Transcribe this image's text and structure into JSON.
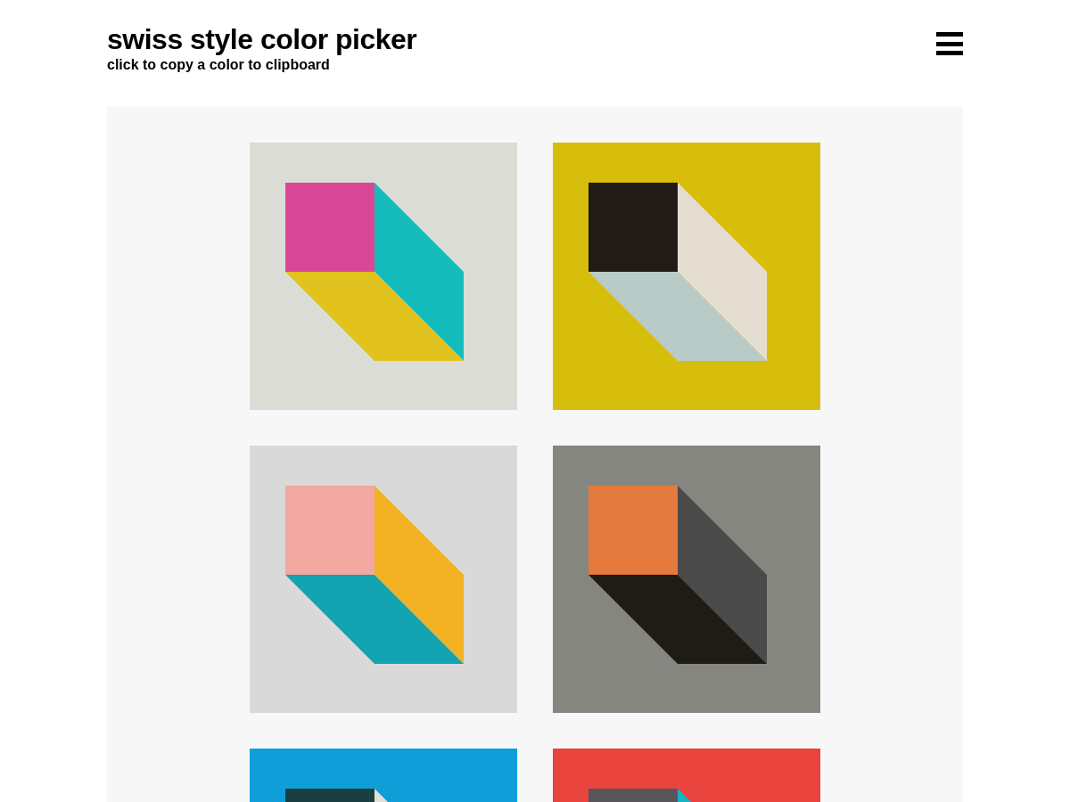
{
  "header": {
    "title": "swiss style color picker",
    "subtitle": "click to copy a color to clipboard"
  },
  "swatches": [
    {
      "faces": [
        {
          "kind": "background",
          "color": "#dcdcd6"
        },
        {
          "kind": "front",
          "color": "#d94896"
        },
        {
          "kind": "side",
          "color": "#14bcbc"
        },
        {
          "kind": "bottom",
          "color": "#e2c21e"
        }
      ]
    },
    {
      "faces": [
        {
          "kind": "background",
          "color": "#d8be0c"
        },
        {
          "kind": "front",
          "color": "#221a14"
        },
        {
          "kind": "side",
          "color": "#e6ddd2"
        },
        {
          "kind": "bottom",
          "color": "#b9cbc6"
        }
      ]
    },
    {
      "faces": [
        {
          "kind": "background",
          "color": "#d9d9d9"
        },
        {
          "kind": "front",
          "color": "#f2a7a0"
        },
        {
          "kind": "side",
          "color": "#f2b224"
        },
        {
          "kind": "bottom",
          "color": "#13a3b0"
        }
      ]
    },
    {
      "faces": [
        {
          "kind": "background",
          "color": "#868681"
        },
        {
          "kind": "front",
          "color": "#e57a3e"
        },
        {
          "kind": "side",
          "color": "#4a4a4a"
        },
        {
          "kind": "bottom",
          "color": "#1e1c14"
        }
      ]
    },
    {
      "faces": [
        {
          "kind": "background",
          "color": "#0f9ed8"
        },
        {
          "kind": "front",
          "color": "#1b3e40"
        },
        {
          "kind": "side",
          "color": "#e2e0d8"
        }
      ]
    },
    {
      "faces": [
        {
          "kind": "background",
          "color": "#e9433e"
        },
        {
          "kind": "front",
          "color": "#57545a"
        },
        {
          "kind": "side",
          "color": "#14b4c4"
        }
      ]
    }
  ]
}
